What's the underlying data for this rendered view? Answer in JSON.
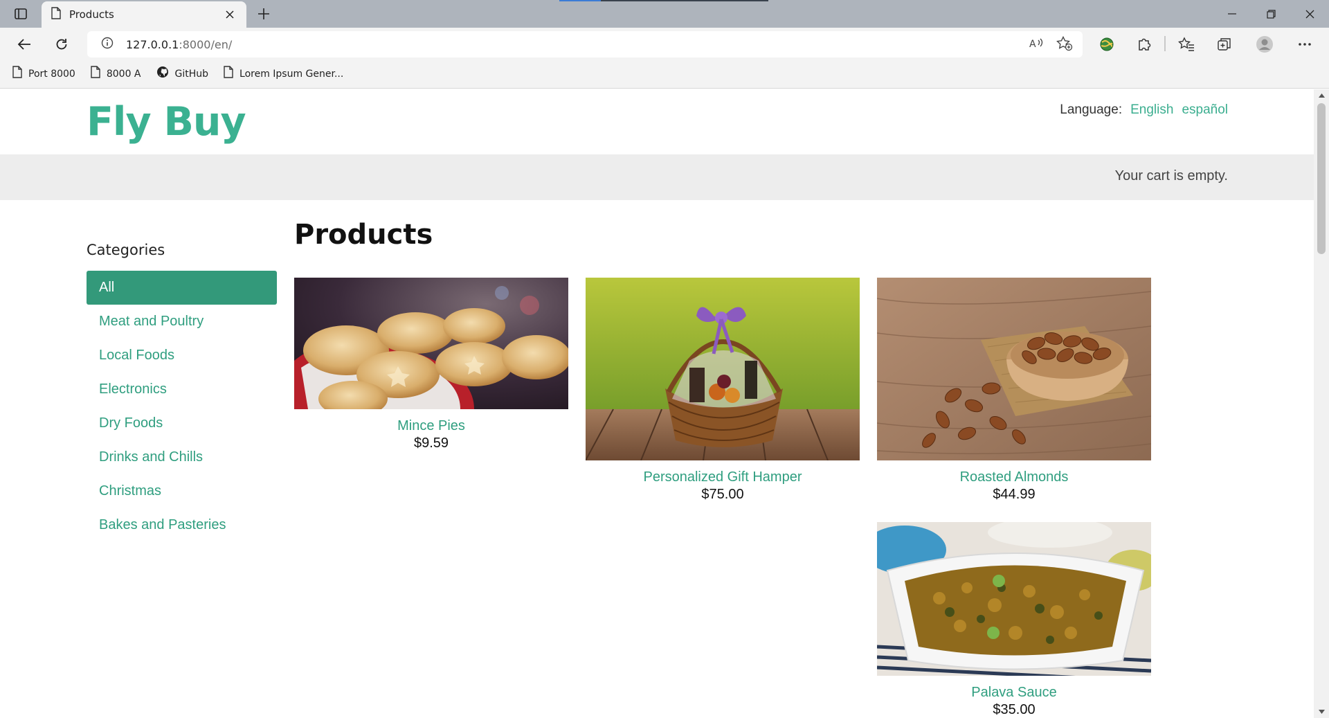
{
  "browser": {
    "tab_title": "Products",
    "url_host": "127.0.0.1",
    "url_rest": ":8000/en/",
    "bookmarks": [
      {
        "label": "Port 8000",
        "icon": "page-icon"
      },
      {
        "label": "8000 A",
        "icon": "page-icon"
      },
      {
        "label": "GitHub",
        "icon": "github-icon"
      },
      {
        "label": "Lorem Ipsum Gener...",
        "icon": "page-icon"
      }
    ]
  },
  "site": {
    "logo": "Fly Buy",
    "language_label": "Language:",
    "languages": [
      "English",
      "español"
    ],
    "cart_text": "Your cart is empty."
  },
  "sidebar": {
    "title": "Categories",
    "items": [
      {
        "label": "All",
        "active": true
      },
      {
        "label": "Meat and Poultry"
      },
      {
        "label": "Local Foods"
      },
      {
        "label": "Electronics"
      },
      {
        "label": "Dry Foods"
      },
      {
        "label": "Drinks and Chills"
      },
      {
        "label": "Christmas"
      },
      {
        "label": "Bakes and Pasteries"
      }
    ]
  },
  "main": {
    "title": "Products",
    "products": [
      {
        "name": "Mince Pies",
        "price": "$9.59",
        "image": "mince-pies-photo"
      },
      {
        "name": "Personalized Gift Hamper",
        "price": "$75.00",
        "image": "gift-hamper-photo"
      },
      {
        "name": "Roasted Almonds",
        "price": "$44.99",
        "image": "roasted-almonds-photo"
      },
      {
        "name": "Palava Sauce",
        "price": "$35.00",
        "image": "palava-sauce-photo"
      }
    ]
  },
  "colors": {
    "accent": "#3bb191",
    "active_category_bg": "#33997a",
    "cart_bar_bg": "#ededed"
  }
}
